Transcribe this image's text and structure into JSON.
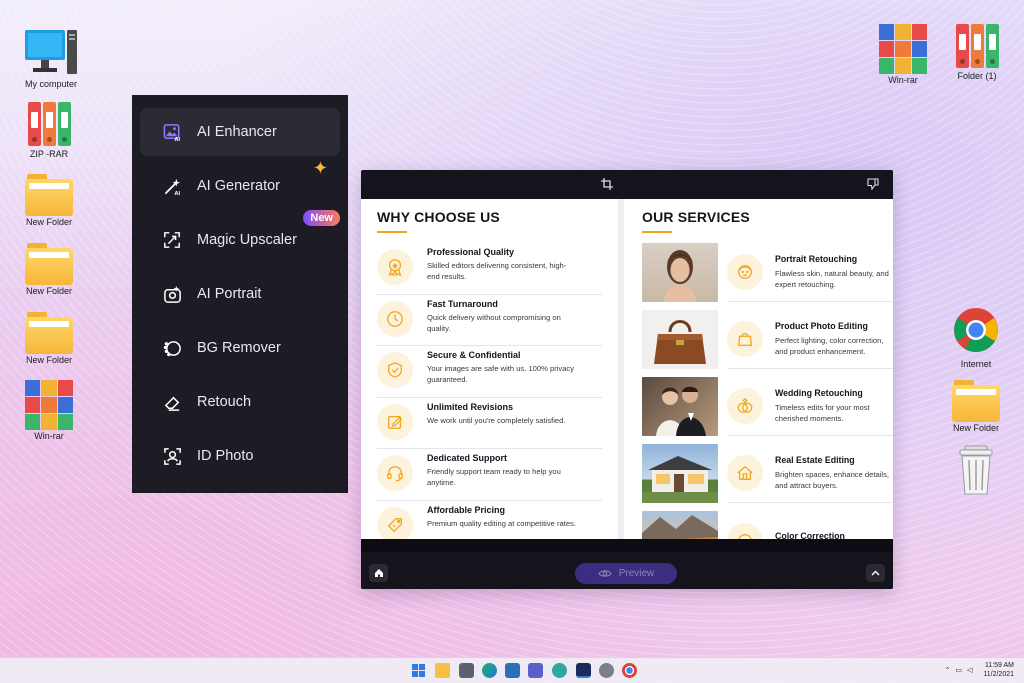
{
  "desktop": {
    "left_icons": [
      {
        "label": "My computer",
        "icon": "computer-icon"
      },
      {
        "label": "ZIP -RAR",
        "icon": "binders-icon"
      },
      {
        "label": "New Folder",
        "icon": "folder-icon"
      },
      {
        "label": "New Folder",
        "icon": "folder-icon"
      },
      {
        "label": "New Folder",
        "icon": "folder-icon"
      },
      {
        "label": "Win-rar",
        "icon": "winrar-icon"
      }
    ],
    "right_icons": [
      {
        "label": "Win-rar",
        "icon": "winrar-icon"
      },
      {
        "label": "Folder (1)",
        "icon": "binders-icon"
      },
      {
        "label": "Internet",
        "icon": "chrome-icon"
      },
      {
        "label": "New Folder",
        "icon": "folder-icon"
      },
      {
        "label": "",
        "icon": "recycle-bin-icon"
      }
    ]
  },
  "menu": {
    "items": [
      {
        "label": "AI Enhancer",
        "icon": "ai-enhancer-icon",
        "active": true
      },
      {
        "label": "AI Generator",
        "icon": "magic-wand-icon",
        "badge": "sparkle"
      },
      {
        "label": "Magic Upscaler",
        "icon": "upscale-icon",
        "badge": "New"
      },
      {
        "label": "AI Portrait",
        "icon": "portrait-icon"
      },
      {
        "label": "BG Remover",
        "icon": "bg-remover-icon"
      },
      {
        "label": "Retouch",
        "icon": "eraser-icon"
      },
      {
        "label": "ID Photo",
        "icon": "id-photo-icon"
      }
    ]
  },
  "preview_window": {
    "why_title": "WHY CHOOSE US",
    "services_title": "OUR SERVICES",
    "why_items": [
      {
        "title": "Professional Quality",
        "desc": "Skilled editors delivering consistent, high-end results.",
        "icon": "award-icon"
      },
      {
        "title": "Fast Turnaround",
        "desc": "Quick delivery without compromising on quality.",
        "icon": "clock-icon"
      },
      {
        "title": "Secure & Confidential",
        "desc": "Your images are safe with us. 100% privacy guaranteed.",
        "icon": "shield-icon"
      },
      {
        "title": "Unlimited Revisions",
        "desc": "We work until you're completely satisfied.",
        "icon": "edit-icon"
      },
      {
        "title": "Dedicated Support",
        "desc": "Friendly support team ready to help you anytime.",
        "icon": "headset-icon"
      },
      {
        "title": "Affordable Pricing",
        "desc": "Premium quality editing at competitive rates.",
        "icon": "price-tag-icon"
      }
    ],
    "services": [
      {
        "title": "Portrait Retouching",
        "desc": "Flawless skin, natural beauty, and expert retouching.",
        "icon": "face-icon",
        "photo": "woman-portrait"
      },
      {
        "title": "Product Photo Editing",
        "desc": "Perfect lighting, color correction, and product enhancement.",
        "icon": "bag-icon",
        "photo": "leather-handbag"
      },
      {
        "title": "Wedding Retouching",
        "desc": "Timeless edits for your most cherished moments.",
        "icon": "rings-icon",
        "photo": "wedding-couple"
      },
      {
        "title": "Real Estate Editing",
        "desc": "Brighten spaces, enhance details, and attract buyers.",
        "icon": "house-icon",
        "photo": "modern-house"
      },
      {
        "title": "Color Correction",
        "desc": "",
        "icon": "palette-icon",
        "photo": "mountain-landscape"
      }
    ],
    "preview_label": "Preview"
  },
  "taskbar": {
    "time": "11:59 AM",
    "date": "11/2/2021"
  },
  "colors": {
    "accent": "#f2a516",
    "menu_bg": "#1d1b24",
    "preview_button": "#3b2e80"
  }
}
